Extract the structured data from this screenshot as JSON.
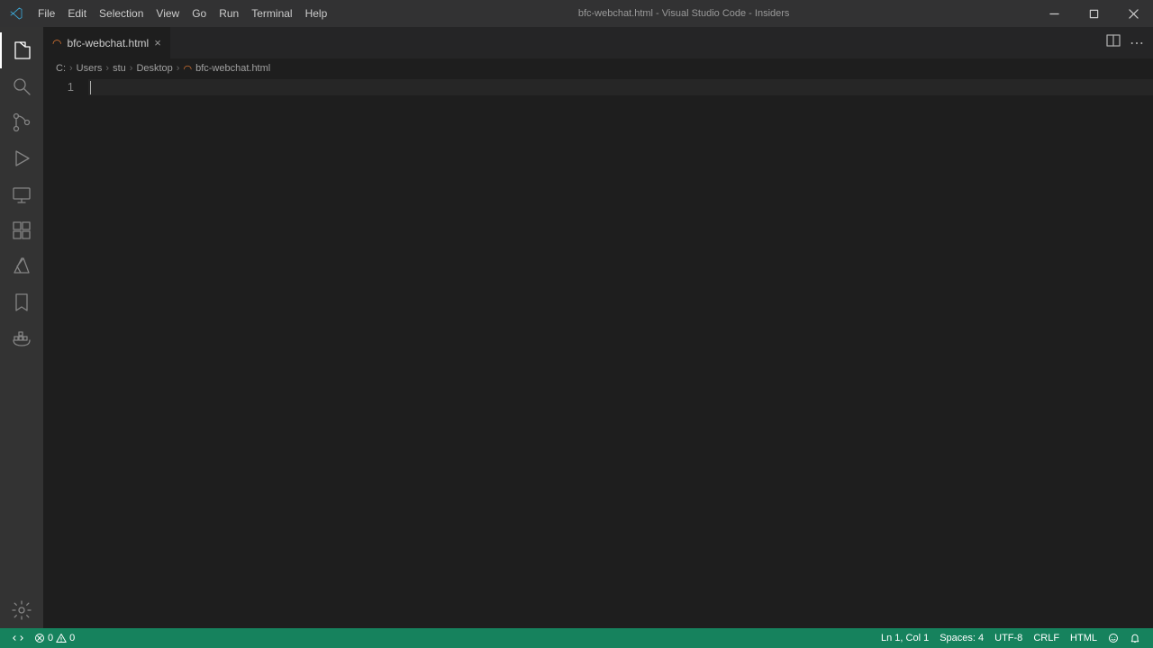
{
  "window": {
    "title": "bfc-webchat.html - Visual Studio Code - Insiders"
  },
  "menu": {
    "file": "File",
    "edit": "Edit",
    "selection": "Selection",
    "view": "View",
    "go": "Go",
    "run": "Run",
    "terminal": "Terminal",
    "help": "Help"
  },
  "tab": {
    "label": "bfc-webchat.html"
  },
  "breadcrumbs": {
    "p0": "C:",
    "p1": "Users",
    "p2": "stu",
    "p3": "Desktop",
    "p4": "bfc-webchat.html"
  },
  "editor": {
    "line1": "1"
  },
  "status": {
    "errors": "0",
    "warnings": "0",
    "cursor": "Ln 1, Col 1",
    "spaces": "Spaces: 4",
    "encoding": "UTF-8",
    "eol": "CRLF",
    "language": "HTML"
  }
}
